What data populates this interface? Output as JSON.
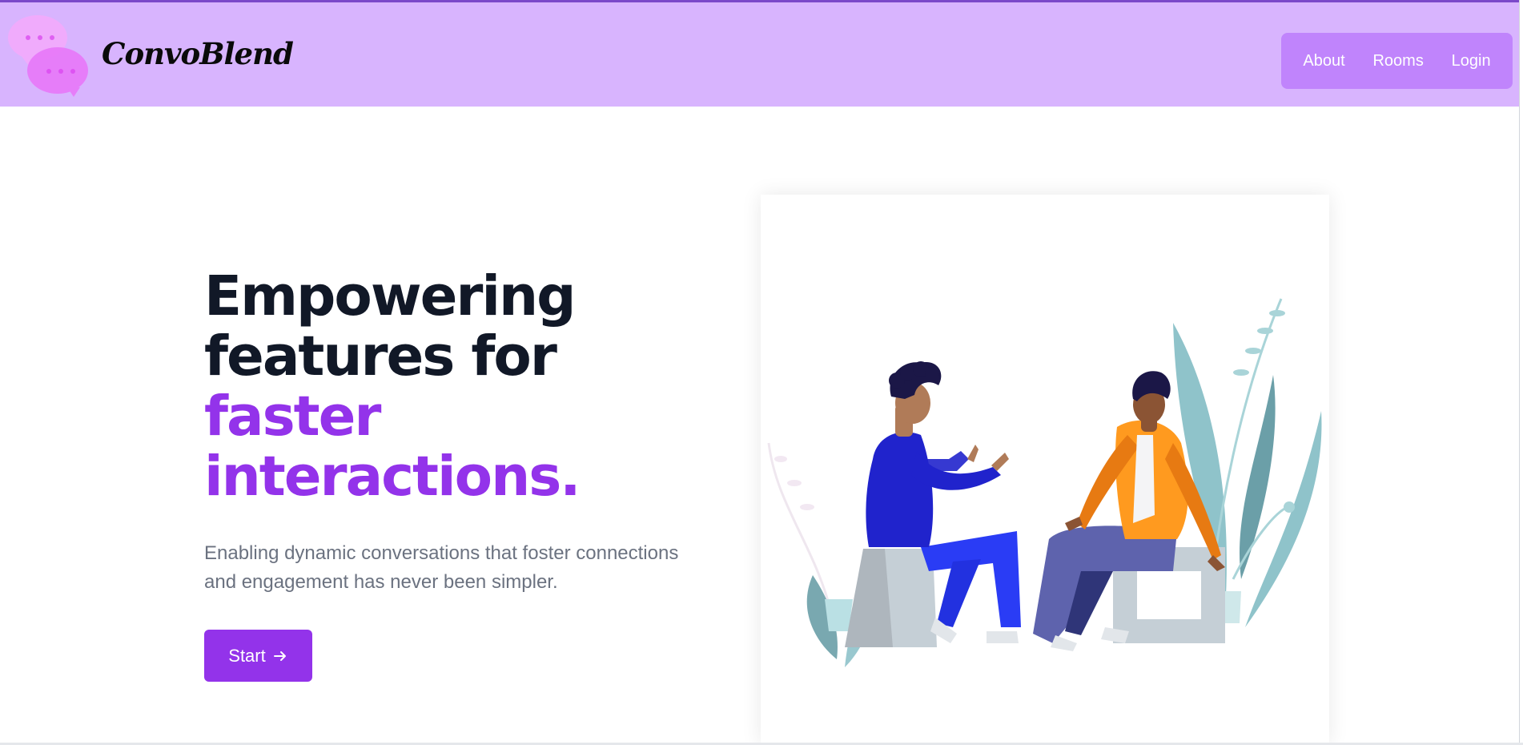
{
  "header": {
    "brand": "ConvoBlend",
    "logo_icon": "chat-bubbles-icon",
    "colors": {
      "header_bg": "#d8b4fe",
      "nav_bg": "#c084fc",
      "top_border": "#7b48c9"
    }
  },
  "nav": {
    "items": [
      {
        "label": "About"
      },
      {
        "label": "Rooms"
      },
      {
        "label": "Login"
      }
    ]
  },
  "hero": {
    "headline_lines": [
      "Empowering",
      "features for"
    ],
    "headline_accent_lines": [
      "faster",
      "interactions."
    ],
    "subtitle_lines": [
      "Enabling dynamic conversations that foster connections",
      "and engagement has never been simpler."
    ],
    "cta_label": "Start",
    "cta_icon": "arrow-right-icon",
    "illustration": "two-people-conversation-illustration",
    "colors": {
      "accent": "#9333ea",
      "headline": "#111827",
      "subtitle": "#6b7280"
    }
  }
}
